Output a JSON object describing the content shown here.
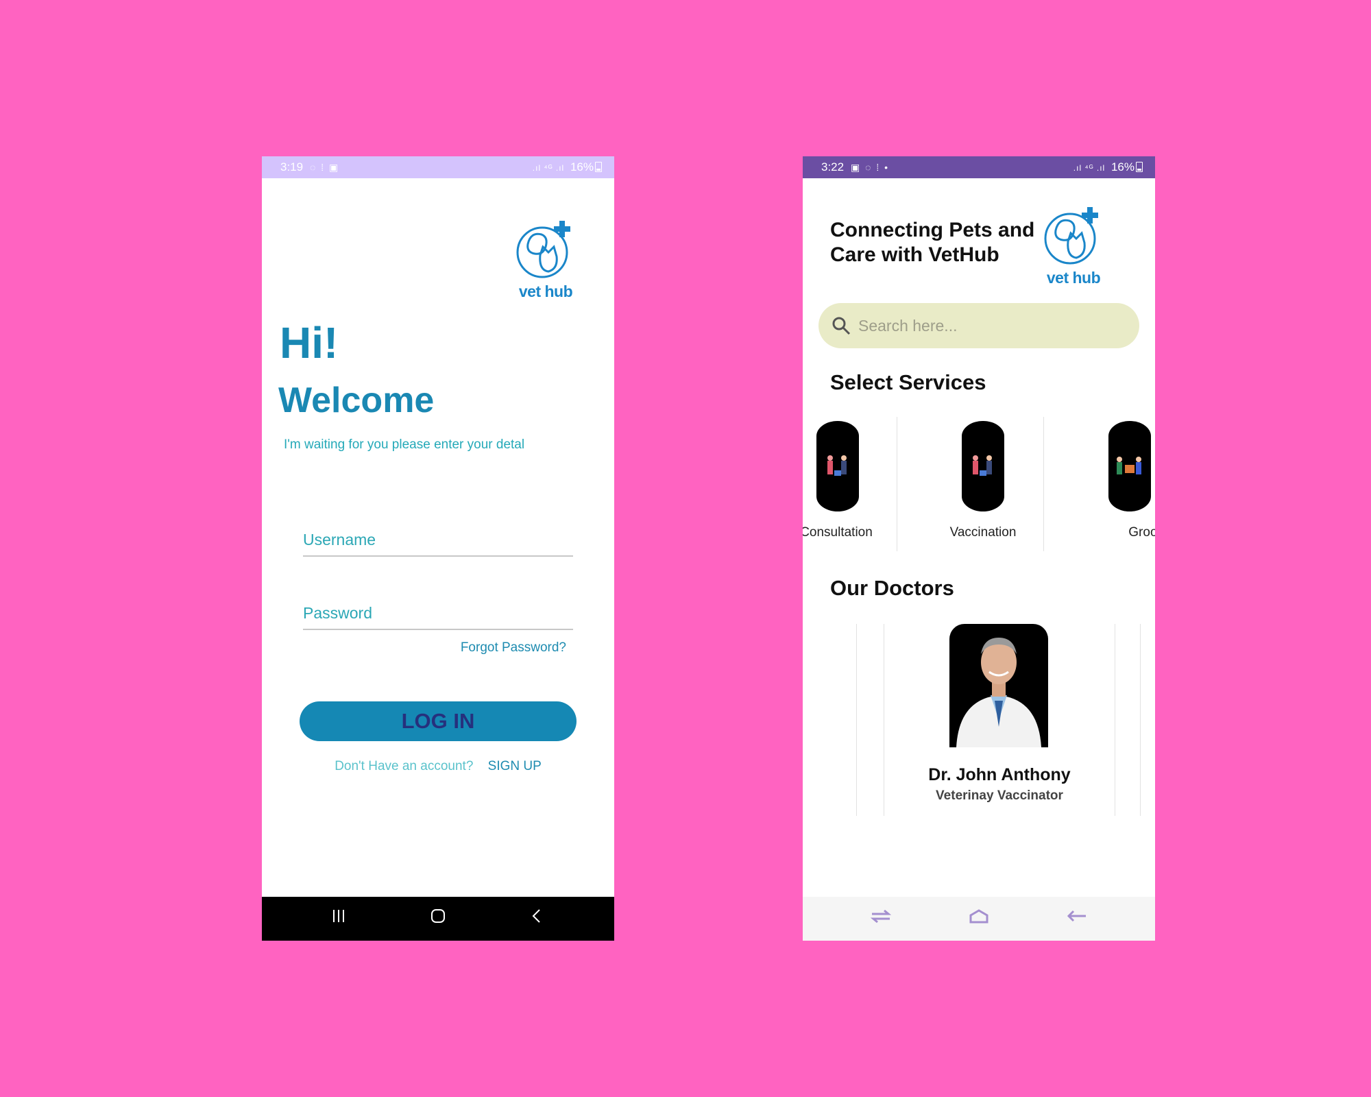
{
  "login_screen": {
    "status_bar": {
      "time": "3:19",
      "battery": "16%"
    },
    "logo_text": "vet hub",
    "greeting": "Hi!",
    "welcome": "Welcome",
    "subtitle": "I'm waiting for you please enter your detal",
    "username_placeholder": "Username",
    "password_placeholder": "Password",
    "forgot_password": "Forgot Password?",
    "login_button": "LOG IN",
    "no_account_text": "Don't Have an account?",
    "signup_link": "SIGN UP"
  },
  "home_screen": {
    "status_bar": {
      "time": "3:22",
      "battery": "16%"
    },
    "tagline": "Connecting Pets and Care with VetHub",
    "logo_text": "vet hub",
    "search_placeholder": "Search here...",
    "services_title": "Select Services",
    "services": [
      {
        "label": "Consultation"
      },
      {
        "label": "Vaccination"
      },
      {
        "label": "Grooming"
      }
    ],
    "doctors_title": "Our Doctors",
    "doctors": [
      {
        "name": "Dr. John Anthony",
        "role": "Veterinay Vaccinator"
      }
    ]
  },
  "colors": {
    "background": "#ff63c1",
    "accent": "#1588b4",
    "login_status_bar": "#d4c3fd",
    "home_status_bar": "#6b4ea3",
    "search_bg": "#e9ebc7"
  }
}
